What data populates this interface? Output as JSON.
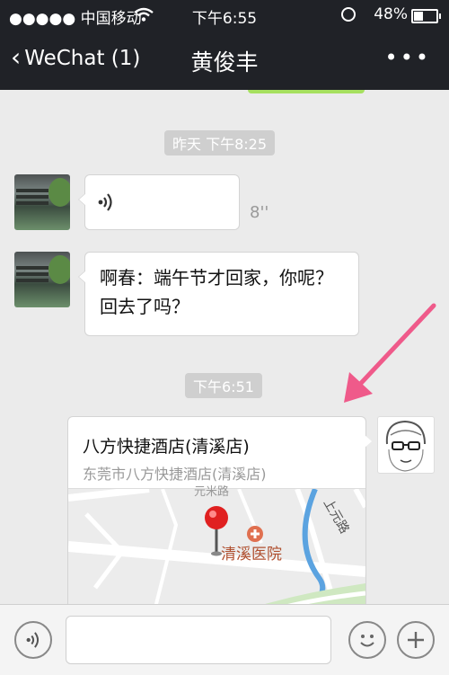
{
  "status_bar": {
    "carrier": "●●●●● 中国移动",
    "time": "下午6:55",
    "battery": "48%"
  },
  "nav": {
    "back_label": "WeChat (1)",
    "title": "黄俊丰"
  },
  "messages": [
    {
      "time_label": "昨天  下午8:25"
    },
    {
      "duration": "8''"
    },
    {
      "text": "啊春：端午节才回家，你呢？回去了吗？"
    },
    {
      "time_label": "下午6:51"
    }
  ],
  "location": {
    "title": "八方快捷酒店(清溪店)",
    "address": "东莞市八方快捷酒店(清溪店)",
    "map_poi": "清溪医院",
    "map_road_top": "元米路",
    "map_road_right": "上元路"
  },
  "colors": {
    "bar_bg": "#202227",
    "chat_bg": "#ebebeb",
    "arrow": "#ef5a8a",
    "pin": "#e02020"
  }
}
